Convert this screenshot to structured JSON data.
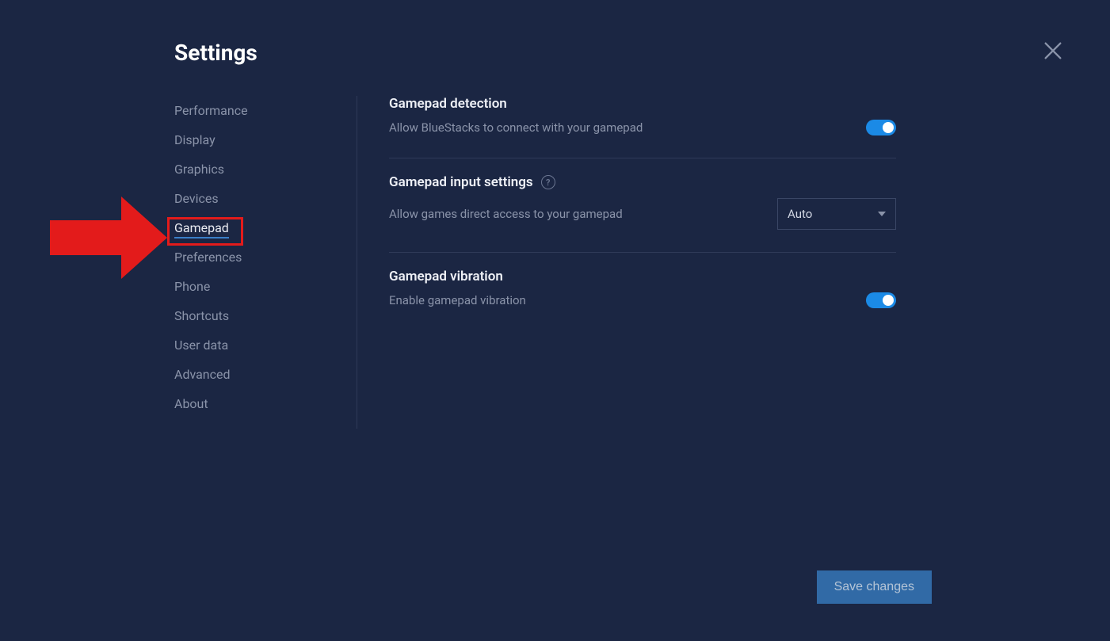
{
  "page": {
    "title": "Settings"
  },
  "sidebar": {
    "items": [
      {
        "label": "Performance",
        "key": "performance"
      },
      {
        "label": "Display",
        "key": "display"
      },
      {
        "label": "Graphics",
        "key": "graphics"
      },
      {
        "label": "Devices",
        "key": "devices"
      },
      {
        "label": "Gamepad",
        "key": "gamepad",
        "active": true
      },
      {
        "label": "Preferences",
        "key": "preferences"
      },
      {
        "label": "Phone",
        "key": "phone"
      },
      {
        "label": "Shortcuts",
        "key": "shortcuts"
      },
      {
        "label": "User data",
        "key": "user-data"
      },
      {
        "label": "Advanced",
        "key": "advanced"
      },
      {
        "label": "About",
        "key": "about"
      }
    ]
  },
  "sections": {
    "detection": {
      "title": "Gamepad detection",
      "desc": "Allow BlueStacks to connect with your gamepad",
      "toggle": true
    },
    "input": {
      "title": "Gamepad input settings",
      "desc": "Allow games direct access to your gamepad",
      "help_glyph": "?",
      "dropdown_value": "Auto"
    },
    "vibration": {
      "title": "Gamepad vibration",
      "desc": "Enable gamepad vibration",
      "toggle": true
    }
  },
  "actions": {
    "save": "Save changes"
  },
  "annotation": {
    "arrow_color": "#e31b1b",
    "highlight_target": "sidebar-item-gamepad"
  }
}
